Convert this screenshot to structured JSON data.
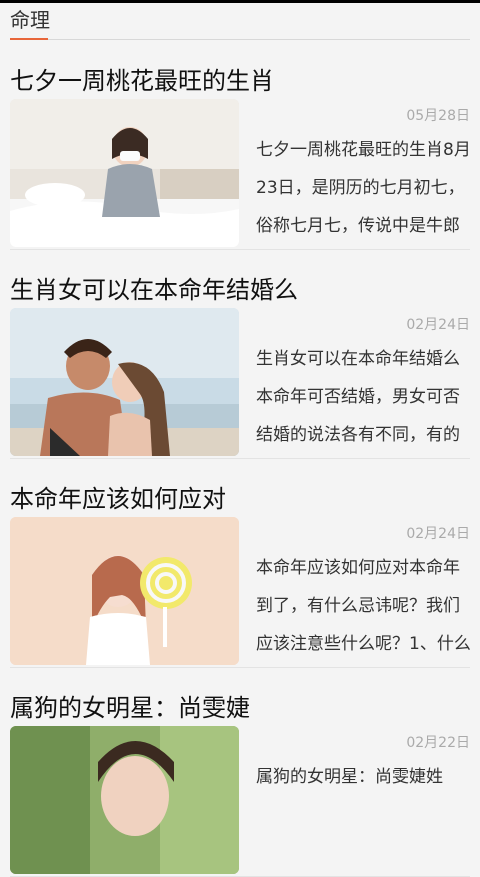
{
  "tab": {
    "label": "命理"
  },
  "articles": [
    {
      "title": "七夕一周桃花最旺的生肖",
      "date": "05月28日",
      "summary": "七夕一周桃花最旺的生肖8月23日，是阴历的七月初七，俗称七月七，传说中是牛郎"
    },
    {
      "title": "生肖女可以在本命年结婚么",
      "date": "02月24日",
      "summary": "生肖女可以在本命年结婚么本命年可否结婚，男女可否结婚的说法各有不同，有的"
    },
    {
      "title": "本命年应该如何应对",
      "date": "02月24日",
      "summary": "本命年应该如何应对本命年到了，有什么忌讳呢？我们应该注意些什么呢？1、什么"
    },
    {
      "title": "属狗的女明星：尚雯婕",
      "date": "02月22日",
      "summary": "属狗的女明星：尚雯婕姓"
    }
  ]
}
